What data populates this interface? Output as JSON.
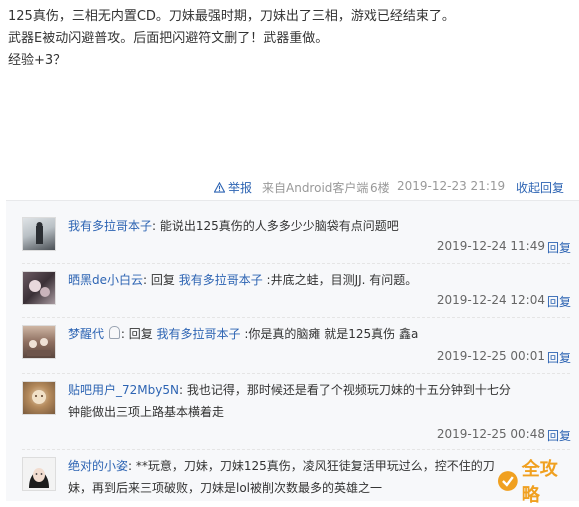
{
  "post": {
    "lines": [
      "125真伤，三相无内置CD。刀妹最强时期，刀妹出了三相，游戏已经结束了。",
      "武器E被动闪避普攻。后面把闪避符文删了！武器重做。",
      "经验+3？"
    ],
    "report_label": "举报",
    "client_label": "来自Android客户端",
    "floor": "6楼",
    "time": "2019-12-23 21:19",
    "collapse_label": "收起回复"
  },
  "replies": [
    {
      "user": "我有多拉哥本子",
      "colon": ":",
      "prefix": "",
      "target": "",
      "content": " 能说出125真伤的人多多少少脑袋有点问题吧",
      "content2": "",
      "time": "2019-12-24 11:49",
      "reply_label": "回复"
    },
    {
      "user": "晒黑de小白云",
      "colon": ":",
      "prefix": " 回复 ",
      "target": "我有多拉哥本子",
      "content": " :井底之蛙，目测JJ. 有问题。",
      "content2": "",
      "time": "2019-12-24 12:04",
      "reply_label": "回复"
    },
    {
      "user": "梦醒代",
      "colon": ":",
      "prefix": " 回复 ",
      "target": "我有多拉哥本子",
      "content": " :你是真的脑瘫 就是125真伤 鑫a",
      "content2": "",
      "time": "2019-12-25 00:01",
      "reply_label": "回复"
    },
    {
      "user": "贴吧用户_72Mby5N",
      "colon": ":",
      "prefix": "",
      "target": "",
      "content": " 我也记得，那时候还是看了个视频玩刀妹的十五分钟到十七分",
      "content2": "钟能做出三项上路基本横着走",
      "time": "2019-12-25 00:48",
      "reply_label": "回复"
    },
    {
      "user": "绝对的小姿",
      "colon": ":",
      "prefix": "",
      "target": "",
      "content": " **玩意，刀妹，刀妹125真伤，凌风狂徒复活甲玩过么，控不住的刀",
      "content2": "妹，再到后来三项破败，刀妹是lol被削次数最多的英雄之一",
      "time": "",
      "reply_label": ""
    }
  ],
  "watermark": "全攻略",
  "colors": {
    "link": "#2d64b3",
    "meta": "#999999",
    "reply_bg": "#f7f8fa",
    "watermark": "#f0a020"
  }
}
